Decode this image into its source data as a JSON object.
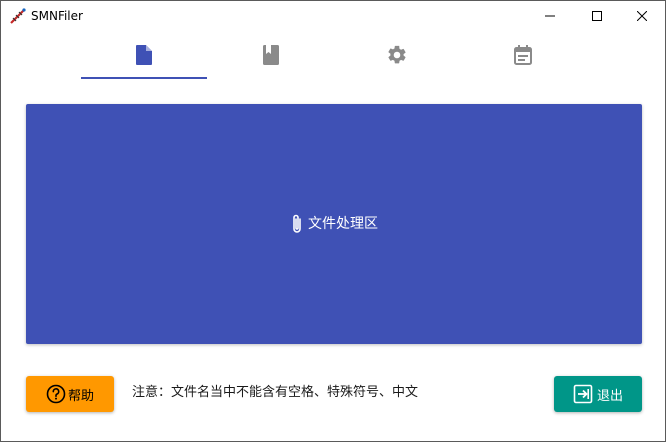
{
  "window": {
    "title": "SMNFiler"
  },
  "tabs": [
    {
      "icon": "file-icon",
      "active": true
    },
    {
      "icon": "book-icon",
      "active": false
    },
    {
      "icon": "gear-icon",
      "active": false
    },
    {
      "icon": "calendar-icon",
      "active": false
    }
  ],
  "dropzone": {
    "label": "文件处理区",
    "icon": "paperclip-icon"
  },
  "footer": {
    "help_label": "帮助",
    "notice": "注意：文件名当中不能含有空格、特殊符号、中文",
    "exit_label": "退出"
  },
  "colors": {
    "primary": "#3f51b5",
    "help": "#ff9800",
    "exit": "#009688",
    "tab_inactive": "#8a8a8a"
  }
}
